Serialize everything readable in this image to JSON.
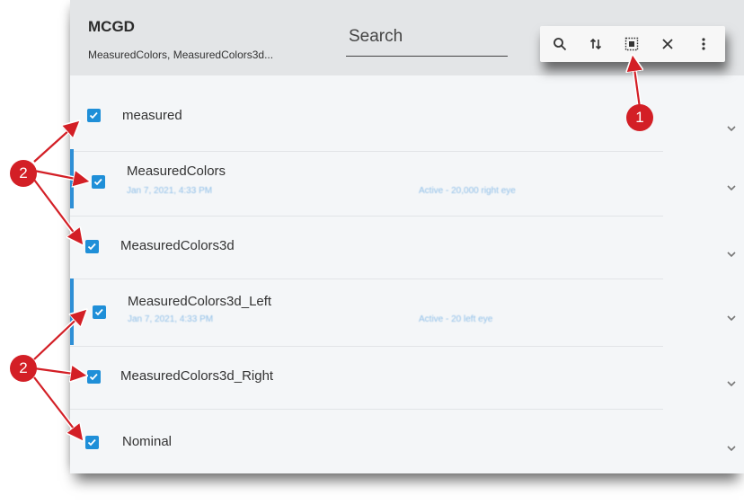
{
  "header": {
    "title": "MCGD",
    "subtitle": "MeasuredColors, MeasuredColors3d...",
    "search_label": "Search"
  },
  "toolbar": {
    "icons": [
      "search-icon",
      "sort-icon",
      "select-all-icon",
      "close-icon",
      "more-vert-icon"
    ],
    "glyphs": [
      "⚲",
      "⇅",
      "⬚",
      "✕",
      "⋮"
    ]
  },
  "rows": [
    {
      "label": "measured",
      "checked": true
    },
    {
      "label": "MeasuredColors",
      "date": "Jan 7, 2021, 4:33 PM",
      "status": "Active - 20,000 right eye",
      "checked": true
    },
    {
      "label": "MeasuredColors3d",
      "checked": true
    },
    {
      "label": "MeasuredColors3d_Left",
      "date": "Jan 7, 2021, 4:33 PM",
      "status": "Active - 20 left eye",
      "checked": true
    },
    {
      "label": "MeasuredColors3d_Right",
      "checked": true
    },
    {
      "label": "Nominal",
      "checked": true
    }
  ],
  "callouts": {
    "one": "1",
    "two_a": "2",
    "two_b": "2"
  },
  "colors": {
    "accent": "#1f8fd8",
    "callout": "#d31f26",
    "header_bg": "#e3e5e7",
    "panel_bg": "#f4f6f8"
  }
}
